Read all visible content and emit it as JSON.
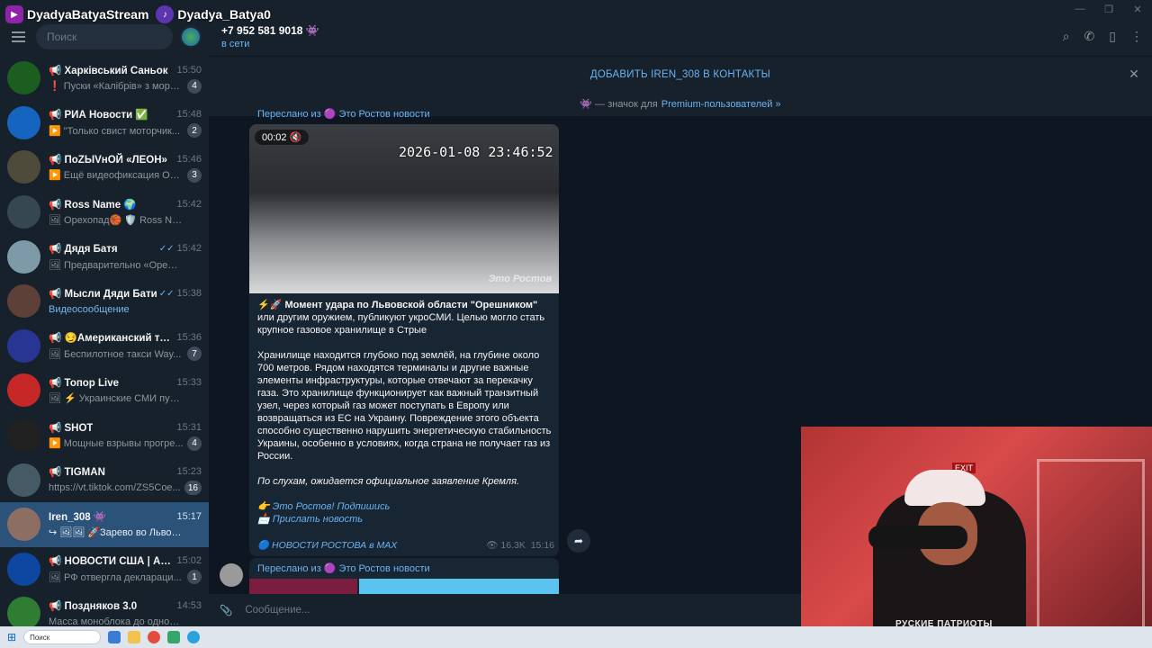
{
  "overlay": {
    "youtube_name": "DyadyaBatyaStream",
    "tiktok_name": "Dyadya_Batya0"
  },
  "sidebar": {
    "search_placeholder": "Поиск",
    "chats": [
      {
        "name": "📢 Харківський Саньок",
        "time": "15:50",
        "preview": "❗ Пуски «Калібрів» з моря ...",
        "badge": "4",
        "avatar_color": "#1b5e20"
      },
      {
        "name": "📢 РИА Новости ✅",
        "time": "15:48",
        "preview": "▶️ \"Только свист моторчик...",
        "badge": "2",
        "avatar_color": "#1565c0"
      },
      {
        "name": "📢 ПоZЫVнОЙ «ЛЕОН»",
        "time": "15:46",
        "preview": "▶️ Ещё видеофиксация Оре...",
        "badge": "3",
        "avatar_color": "#4e4b3a"
      },
      {
        "name": "📢 Ross Name 🌍",
        "time": "15:42",
        "preview": "🖼 Орехопад🏀 🛡️ Ross Name",
        "badge": "",
        "avatar_color": "#37474f"
      },
      {
        "name": "📢 Дядя Батя",
        "time": "15:42",
        "preview": "🖼 Предварительно «Орешник...",
        "badge": "",
        "check": "✓✓",
        "avatar_color": "#7e9aa8"
      },
      {
        "name": "📢 Мысли Дяди Бати",
        "time": "15:38",
        "preview": "Видеосообщение",
        "badge": "",
        "check": "✓✓",
        "link": true,
        "avatar_color": "#5d4037"
      },
      {
        "name": "📢 😏Американский тре...",
        "time": "15:36",
        "preview": "🖼 Беспилотное такси Way...",
        "badge": "7",
        "avatar_color": "#283593"
      },
      {
        "name": "📢 Топор Live",
        "time": "15:33",
        "preview": "🖼 ⚡ Украинские СМИ публик...",
        "badge": "",
        "avatar_color": "#c62828"
      },
      {
        "name": "📢 SHOT",
        "time": "15:31",
        "preview": "▶️ Мощные взрывы прогре...",
        "badge": "4",
        "avatar_color": "#212121"
      },
      {
        "name": "📢 TIGMAN",
        "time": "15:23",
        "preview": "https://vt.tiktok.com/ZS5Coe...",
        "badge": "16",
        "avatar_color": "#455a64"
      },
      {
        "name": "Iren_308 👾",
        "time": "15:17",
        "preview": "↪ 🖼🖼 🚀Зарево во Львовск...",
        "badge": "",
        "selected": true,
        "avatar_color": "#8d6e63"
      },
      {
        "name": "📢 НОВОСТИ США | АМЕ...",
        "time": "15:02",
        "preview": "🖼 РФ отвергла деклараци...",
        "badge": "1",
        "avatar_color": "#0d47a1"
      },
      {
        "name": "📢 Поздняков 3.0",
        "time": "14:53",
        "preview": "Масса моноблока до одной тон...",
        "badge": "",
        "avatar_color": "#2e7d32"
      }
    ]
  },
  "header": {
    "name": "+7 952 581 9018 👾",
    "status": "в сети"
  },
  "add_contact": {
    "label": "ДОБАВИТЬ IREN_308 В КОНТАКТЫ"
  },
  "premium": {
    "text": "👾 — значок для",
    "link": "Premium-пользователей »"
  },
  "message": {
    "forwarded_top": "Переслано из 🟣 Это Ростов новости",
    "video_time": "00:02 🔇",
    "video_datestamp": "2026-01-08 23:46:52",
    "watermark": "Это Ростов",
    "title_emoji": "⚡🚀 ",
    "title": "Момент удара по Львовской области \"Орешником\"",
    "title_rest": " или другим оружием, публикуют укроСМИ. Целью могло стать крупное газовое хранилище в Стрые",
    "para2": "Хранилище находится глубоко под землёй, на глубине около 700 метров. Рядом находятся терминалы и другие важные элементы инфраструктуры, которые отвечают за перекачку газа. Это хранилище функционирует как важный транзитный узел, через который газ может поступать в Европу или возвращаться из ЕС на Украину. Повреждение этого объекта способно существенно нарушить энергетическую стабильность Украины, особенно в условиях, когда страна не получает газ из России.",
    "para3": "По слухам, ожидается официальное заявление Кремля.",
    "link1": "👉 Это Ростов! Подпишись",
    "link2": "📩 Прислать новость",
    "source": "🔵 НОВОСТИ РОСТОВА в MAX",
    "views": "👁 16.3K",
    "time": "15:16"
  },
  "message2": {
    "forwarded": "Переслано из 🟣 Это Ростов новости"
  },
  "compose": {
    "placeholder": "Сообщение..."
  },
  "webcam": {
    "shirt_text": "РУСКИЕ ПАТРИОТЫ",
    "exit_sign": "EXIT"
  },
  "taskbar": {
    "search": "Поиск"
  }
}
